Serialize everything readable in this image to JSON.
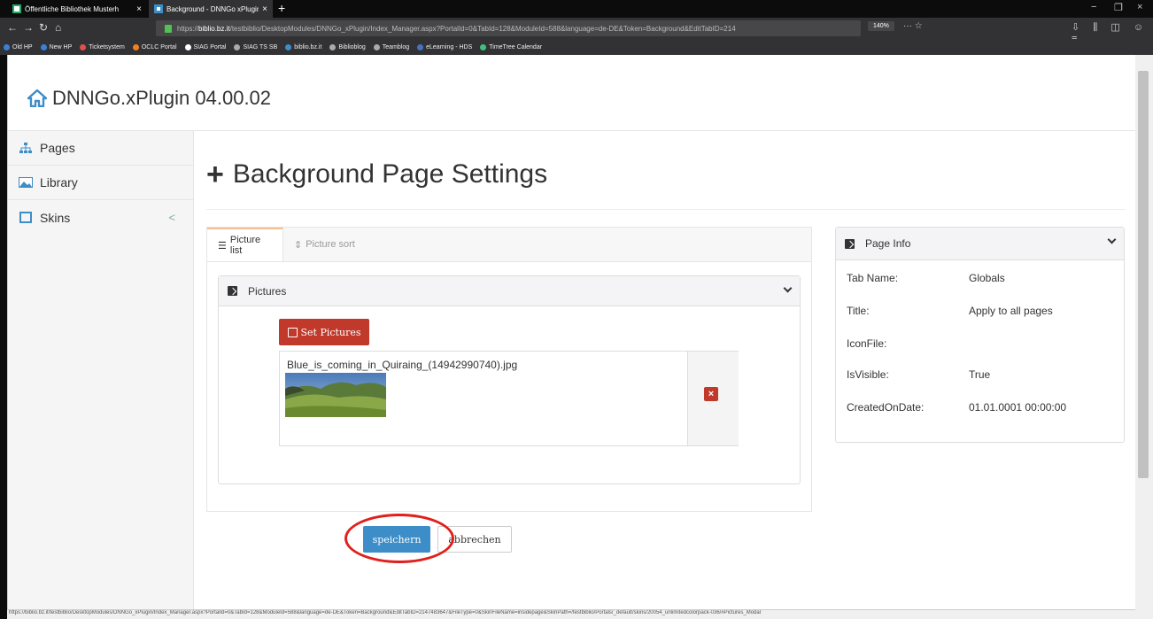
{
  "browser": {
    "tabs": [
      {
        "title": "Öffentliche Bibliothek Musterh",
        "close": "×"
      },
      {
        "title": "Background - DNNGo xPlugin",
        "close": "×"
      }
    ],
    "new_tab": "+",
    "window_controls": [
      "−",
      "❐",
      "×"
    ],
    "url_prefix": "https://",
    "url_domain": "biblio.bz.it",
    "url_rest": "/testbiblio/DesktopModules/DNNGo_xPlugin/Index_Manager.aspx?PortalId=0&TabId=128&ModuleId=588&language=de-DE&Token=Background&EditTabID=214",
    "zoom": "140%",
    "url_icons": "··· ☆",
    "toolbar_icons": "⇩ ⫼ ◫ ☺ ≡",
    "bookmarks": [
      {
        "label": "Old HP",
        "color": "#3c7fd8"
      },
      {
        "label": "New HP",
        "color": "#3c7fd8"
      },
      {
        "label": "Ticketsystem",
        "color": "#e05050"
      },
      {
        "label": "OCLC Portal",
        "color": "#f08020"
      },
      {
        "label": "SIAG Portal",
        "color": "#ffffff"
      },
      {
        "label": "SIAG TS SB",
        "color": "#aaaaaa"
      },
      {
        "label": "biblio.bz.it",
        "color": "#3c8dc8"
      },
      {
        "label": "Biblioblog",
        "color": "#aaaaaa"
      },
      {
        "label": "Teamblog",
        "color": "#aaaaaa"
      },
      {
        "label": "eLearning - HDS",
        "color": "#4a6fc8"
      },
      {
        "label": "TimeTree Calendar",
        "color": "#40c080"
      }
    ],
    "status_url": "https://biblio.bz.it/testbiblio/DesktopModules/DNNGo_xPlugin/Index_Manager.aspx?PortalId=0&TabId=128&ModuleId=588&language=de-DE&Token=Background&EditTabID=2147483647&FileType=0&SkinFileName=insidepage&SkinPath=/testbiblio/Portals/_default/skins/20054_unlimitedcolorpack-036/#Pictures_Modal"
  },
  "app": {
    "title": "DNNGo.xPlugin 04.00.02",
    "accent": "#3c8dc8"
  },
  "sidebar": {
    "items": [
      {
        "label": "Pages"
      },
      {
        "label": "Library"
      },
      {
        "label": "Skins",
        "chevron": "<"
      }
    ]
  },
  "main": {
    "page_title": "Background Page Settings",
    "plus": "+",
    "tabs": [
      {
        "label": "Picture list",
        "icon": "☰"
      },
      {
        "label": "Picture sort",
        "icon": "⇕"
      }
    ],
    "pictures_panel": {
      "title": "Pictures",
      "set_button": "Set Pictures",
      "items": [
        {
          "filename": "Blue_is_coming_in_Quiraing_(14942990740).jpg",
          "delete": "×"
        }
      ]
    },
    "save_label": "speichern",
    "cancel_label": "abbrechen"
  },
  "page_info": {
    "title": "Page Info",
    "rows": [
      {
        "key": "Tab Name:",
        "value": "Globals"
      },
      {
        "key": "Title:",
        "value": "Apply to all pages"
      },
      {
        "key": "IconFile:",
        "value": ""
      },
      {
        "key": "IsVisible:",
        "value": "True"
      },
      {
        "key": "CreatedOnDate:",
        "value": "01.01.0001 00:00:00"
      }
    ]
  }
}
